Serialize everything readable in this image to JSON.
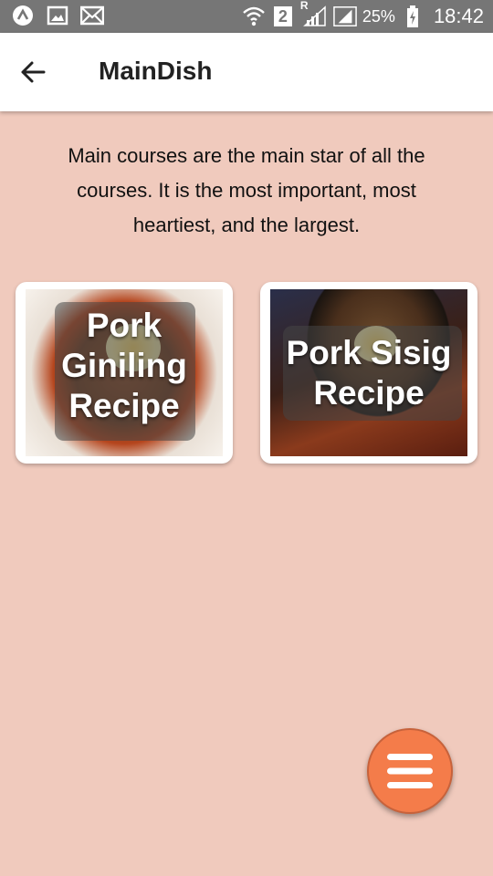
{
  "status_bar": {
    "battery": "25%",
    "time": "18:42",
    "sim_slot": "2",
    "roaming": "R",
    "icons": [
      "app-icon",
      "image-icon",
      "mail-icon",
      "wifi-icon",
      "sim-icon",
      "signal-icon",
      "battery-icon"
    ]
  },
  "app_bar": {
    "title": "MainDish",
    "back_icon": "arrow-left-icon"
  },
  "description": "Main courses are the main star of all the courses. It is the most important, most heartiest, and the largest.",
  "cards": [
    {
      "label_lines": [
        "Pork",
        "Giniling",
        "Recipe"
      ]
    },
    {
      "label_lines": [
        "Pork Sisig",
        "Recipe"
      ]
    }
  ],
  "fab": {
    "icon": "menu-icon"
  },
  "colors": {
    "background": "#f0cabd",
    "status_bar": "#767676",
    "app_bar": "#ffffff",
    "fab": "#f47c4a"
  }
}
